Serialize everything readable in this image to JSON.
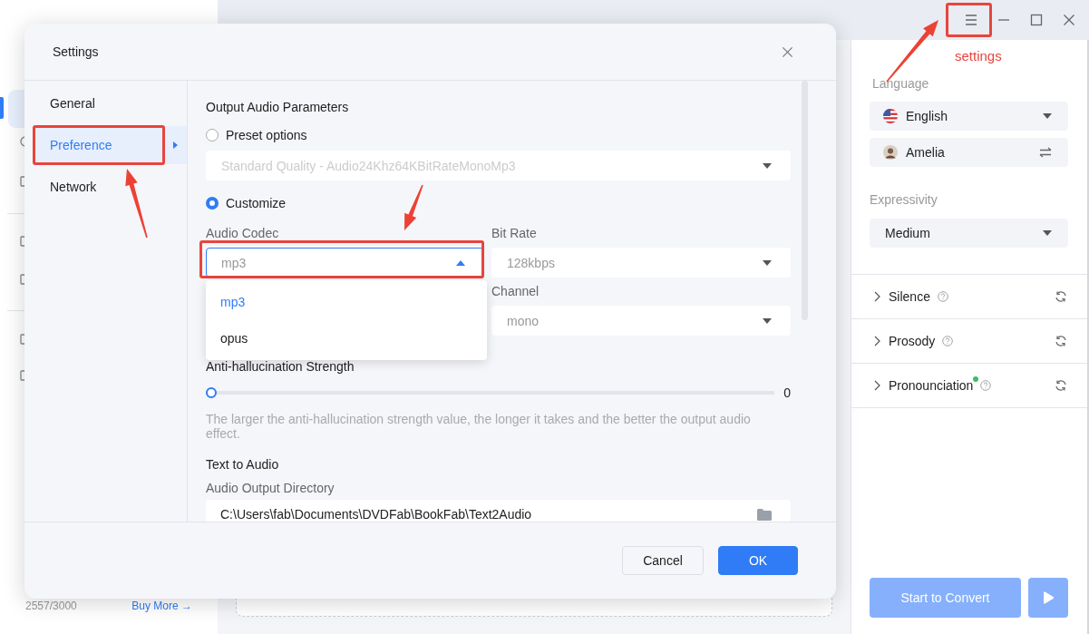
{
  "sidebar": {
    "usage": "2557/3000",
    "buy_more": "Buy More →"
  },
  "right_panel": {
    "language_label": "Language",
    "language": "English",
    "voice": "Amelia",
    "expressivity_label": "Expressivity",
    "expressivity": "Medium",
    "sections": [
      {
        "label": "Silence",
        "expanded": false,
        "indicator": false
      },
      {
        "label": "Prosody",
        "expanded": false,
        "indicator": false
      },
      {
        "label": "Pronounciation",
        "expanded": false,
        "indicator": true
      }
    ],
    "start_button": {
      "label": "Start to Convert",
      "disabled": true
    }
  },
  "dialog": {
    "title": "Settings",
    "nav": [
      {
        "label": "General",
        "selected": false
      },
      {
        "label": "Preference",
        "selected": true
      },
      {
        "label": "Network",
        "selected": false
      }
    ],
    "section_title": "Output Audio Parameters",
    "preset": {
      "label": "Preset options",
      "selected": false,
      "value": "Standard Quality - Audio24Khz64KBitRateMonoMp3",
      "disabled": true
    },
    "customize": {
      "label": "Customize",
      "selected": true
    },
    "codec": {
      "label": "Audio Codec",
      "value": "mp3",
      "open": true,
      "options": [
        {
          "label": "mp3",
          "selected": true
        },
        {
          "label": "opus",
          "selected": false
        }
      ]
    },
    "bit_rate": {
      "label": "Bit Rate",
      "value": "128kbps"
    },
    "channel": {
      "label": "Channel",
      "value": "mono"
    },
    "slider": {
      "label": "Anti-hallucination Strength",
      "level": 0,
      "reading": "0"
    },
    "hint": "The larger the anti-hallucination strength value, the longer it takes and the better the output audio effect.",
    "text_to_audio": "Text to Audio",
    "directory": {
      "label": "Audio Output Directory",
      "value": "C:\\Users\\fab\\Documents\\DVDFab\\BookFab\\Text2Audio"
    },
    "buttons": [
      {
        "label": "Cancel",
        "kind": "secondary"
      },
      {
        "label": "OK",
        "kind": "primary"
      }
    ]
  },
  "annotations": [
    {
      "kind": "frame"
    },
    {
      "kind": "frame"
    },
    {
      "kind": "frame"
    },
    {
      "kind": "arrow"
    },
    {
      "kind": "arrow"
    },
    {
      "kind": "arrow"
    },
    {
      "kind": "label",
      "text": "settings"
    }
  ]
}
